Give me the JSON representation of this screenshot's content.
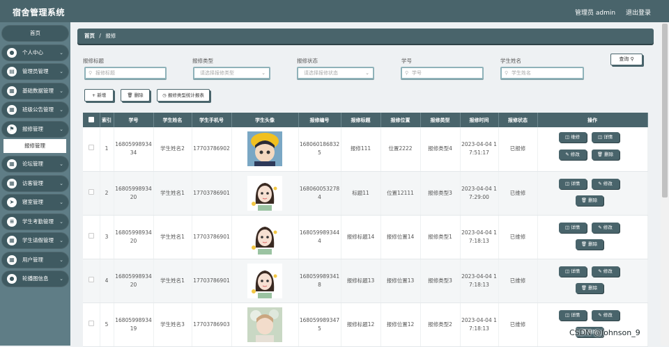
{
  "app": {
    "title": "宿舍管理系统"
  },
  "header": {
    "user": "管理员 admin",
    "logout": "退出登录"
  },
  "sidebar": {
    "home": "首页",
    "items": [
      {
        "label": "个人中心",
        "icon": "user-icon"
      },
      {
        "label": "管理员管理",
        "icon": "admin-icon"
      },
      {
        "label": "基础数据管理",
        "icon": "grid-icon"
      },
      {
        "label": "班级公告管理",
        "icon": "grid-icon"
      },
      {
        "label": "报修管理",
        "icon": "flag-icon"
      },
      {
        "label": "论坛管理",
        "icon": "grid-icon"
      },
      {
        "label": "访客管理",
        "icon": "grid-icon"
      },
      {
        "label": "寝室管理",
        "icon": "send-icon"
      },
      {
        "label": "学生考勤管理",
        "icon": "list-icon"
      },
      {
        "label": "学生请假管理",
        "icon": "grid-icon"
      },
      {
        "label": "用户管理",
        "icon": "grid-icon"
      },
      {
        "label": "轮播图信息",
        "icon": "user-icon"
      }
    ],
    "active_sub": "报修管理"
  },
  "breadcrumb": {
    "home": "首页",
    "sep": "/",
    "current": "报修"
  },
  "filters": {
    "title_label": "报修标题",
    "title_placeholder": "报修标题",
    "type_label": "报修类型",
    "type_placeholder": "请选择报修类型",
    "status_label": "报修状态",
    "status_placeholder": "请选择报修状态",
    "student_no_label": "学号",
    "student_no_placeholder": "学号",
    "student_name_label": "学生姓名",
    "student_name_placeholder": "学生姓名",
    "search": "查询 ⚲"
  },
  "actions": {
    "add": "+ 新增",
    "delete": "🗑 删除",
    "stats": "◷ 报修类型统计报表"
  },
  "table": {
    "headers": [
      "索引",
      "学号",
      "学生姓名",
      "学生手机号",
      "学生头像",
      "报修编号",
      "报修标题",
      "报修位置",
      "报修类型",
      "报修时间",
      "报修状态",
      "操作"
    ],
    "rows": [
      {
        "index": "1",
        "student_no": "1680599893434",
        "name": "学生姓名2",
        "phone": "17703786902",
        "repair_no": "1680601868325",
        "title": "报修111",
        "location": "位置2222",
        "type": "报修类型4",
        "time": "2023-04-04 17:51:17",
        "status": "已报修",
        "ops": [
          "◫ 维修",
          "◫ 详情",
          "✎ 修改",
          "🗑 删除"
        ]
      },
      {
        "index": "2",
        "student_no": "1680599893420",
        "name": "学生姓名1",
        "phone": "17703786901",
        "repair_no": "1680600532784",
        "title": "标题11",
        "location": "位置12111",
        "type": "报修类型3",
        "time": "2023-04-04 17:29:00",
        "status": "已维修",
        "ops": [
          "◫ 详情",
          "✎ 修改",
          "🗑 删除"
        ]
      },
      {
        "index": "3",
        "student_no": "1680599893420",
        "name": "学生姓名1",
        "phone": "17703786901",
        "repair_no": "1680599893444",
        "title": "报修标题14",
        "location": "报修位置14",
        "type": "报修类型1",
        "time": "2023-04-04 17:18:13",
        "status": "已维修",
        "ops": [
          "◫ 详情",
          "✎ 修改",
          "🗑 删除"
        ]
      },
      {
        "index": "4",
        "student_no": "1680599893420",
        "name": "学生姓名1",
        "phone": "17703786901",
        "repair_no": "1680599893418",
        "title": "报修标题13",
        "location": "报修位置13",
        "type": "报修类型3",
        "time": "2023-04-04 17:18:13",
        "status": "已维修",
        "ops": [
          "◫ 详情",
          "✎ 修改",
          "🗑 删除"
        ]
      },
      {
        "index": "5",
        "student_no": "1680599893419",
        "name": "学生姓名3",
        "phone": "17703786903",
        "repair_no": "1680599893475",
        "title": "报修标题12",
        "location": "报修位置12",
        "type": "报修类型2",
        "time": "2023-04-04 17:18:13",
        "status": "已维修",
        "ops": [
          "◫ 详情",
          "✎ 修改",
          "🗑 删除"
        ]
      }
    ]
  },
  "watermark": "CSDN @Johnson_9",
  "colors": {
    "primary": "#49646b",
    "sidebar": "#5f7d86",
    "nav_item": "#3f5a61"
  }
}
